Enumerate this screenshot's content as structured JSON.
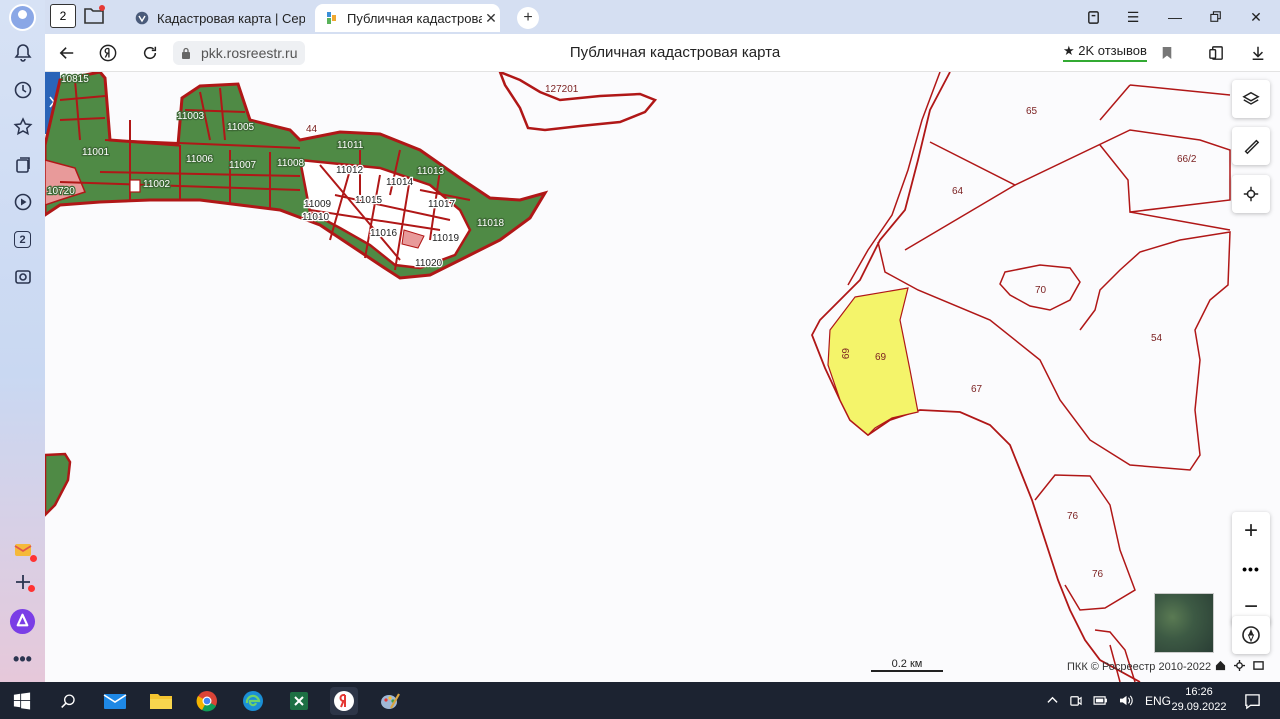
{
  "browser": {
    "tabs": [
      {
        "label": "Кадастровая карта | Серв",
        "active": false
      },
      {
        "label": "Публичная кадастровая",
        "active": true
      }
    ],
    "home_badge": "2",
    "sidebar_badge": "2",
    "url": "pkk.rosreestr.ru",
    "page_title": "Публичная кадастровая карта",
    "reviews": "★ 2K отзывов"
  },
  "map": {
    "cluster_labels": [
      "10815",
      "11003",
      "11005",
      "44",
      "11001",
      "11006",
      "11007",
      "11008",
      "11011",
      "11002",
      "11012",
      "11014",
      "11013",
      "10720",
      "11015",
      "11017",
      "11009",
      "11010",
      "11016",
      "11018",
      "11019",
      "11020"
    ],
    "parcel_labels": [
      "127201",
      "65",
      "66/2",
      "64",
      "70",
      "54",
      "69",
      "69",
      "67",
      "76",
      "76"
    ],
    "selected_parcel": "69",
    "scale_label": "0.2 км",
    "copyright": "ПКК © Росреестр 2010-2022",
    "colors": {
      "boundary": "#b01717",
      "green_fill": "#4f8a45",
      "selected_fill": "#f4f46a",
      "pink_fill": "#e89a9a"
    }
  },
  "taskbar": {
    "language": "ENG",
    "time": "16:26",
    "date": "29.09.2022"
  }
}
